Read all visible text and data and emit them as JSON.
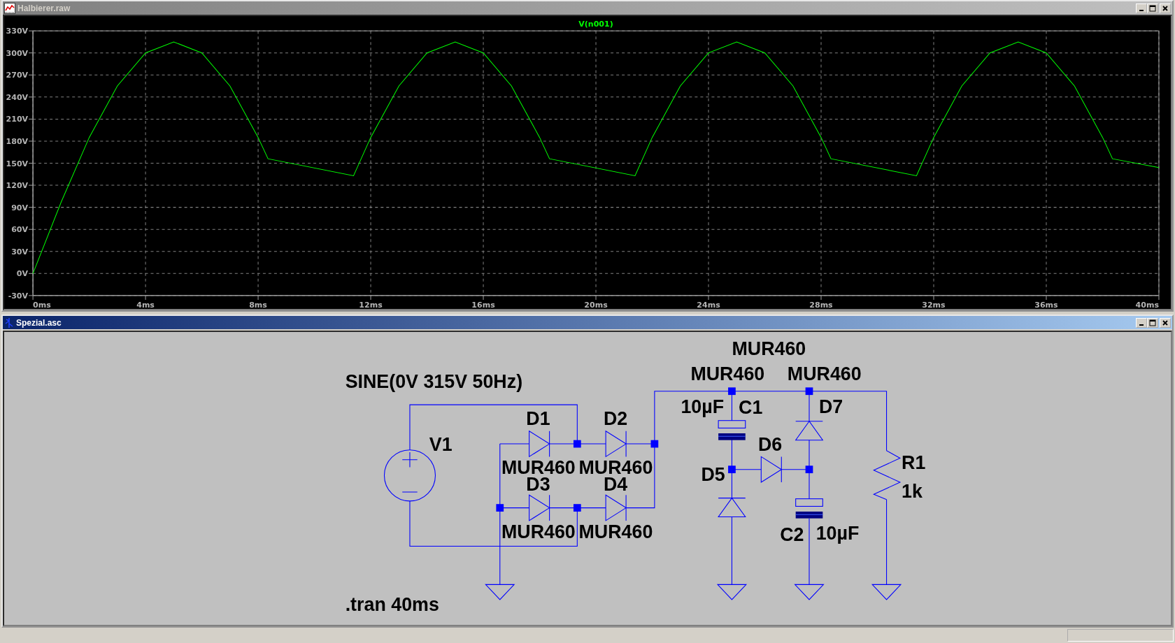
{
  "plot_window": {
    "title": "Halbierer.raw",
    "active": false,
    "chart_data": {
      "type": "line",
      "grid": true,
      "x": [
        0,
        1,
        2,
        3,
        4,
        5,
        6,
        7,
        8,
        8.35,
        11.39,
        12,
        13,
        14,
        15,
        16,
        17,
        18,
        18.35,
        21.39,
        22,
        23,
        24,
        25,
        26,
        27,
        28,
        28.35,
        31.39,
        32,
        33,
        34,
        35,
        36,
        37,
        38,
        38.35,
        40
      ],
      "series": [
        {
          "name": "V(n001)",
          "color": "#00ff00",
          "values": [
            0,
            97,
            185,
            255,
            300,
            315,
            300,
            255,
            185,
            156,
            133,
            185,
            255,
            300,
            315,
            300,
            255,
            185,
            156,
            133,
            185,
            255,
            300,
            315,
            300,
            255,
            185,
            156,
            133,
            185,
            255,
            300,
            315,
            300,
            255,
            185,
            156,
            144
          ]
        }
      ],
      "xlim": [
        0,
        40
      ],
      "ylim": [
        -30,
        330
      ],
      "xticks": [
        {
          "value": 0,
          "label": "0ms"
        },
        {
          "value": 4,
          "label": "4ms"
        },
        {
          "value": 8,
          "label": "8ms"
        },
        {
          "value": 12,
          "label": "12ms"
        },
        {
          "value": 16,
          "label": "16ms"
        },
        {
          "value": 20,
          "label": "20ms"
        },
        {
          "value": 24,
          "label": "24ms"
        },
        {
          "value": 28,
          "label": "28ms"
        },
        {
          "value": 32,
          "label": "32ms"
        },
        {
          "value": 36,
          "label": "36ms"
        },
        {
          "value": 40,
          "label": "40ms"
        }
      ],
      "yticks": [
        {
          "value": 330,
          "label": "330V"
        },
        {
          "value": 300,
          "label": "300V"
        },
        {
          "value": 270,
          "label": "270V"
        },
        {
          "value": 240,
          "label": "240V"
        },
        {
          "value": 210,
          "label": "210V"
        },
        {
          "value": 180,
          "label": "180V"
        },
        {
          "value": 150,
          "label": "150V"
        },
        {
          "value": 120,
          "label": "120V"
        },
        {
          "value": 90,
          "label": "90V"
        },
        {
          "value": 60,
          "label": "60V"
        },
        {
          "value": 30,
          "label": "30V"
        },
        {
          "value": 0,
          "label": "0V"
        },
        {
          "value": -30,
          "label": "-30V"
        }
      ]
    }
  },
  "schematic_window": {
    "title": "Spezial.asc",
    "active": true,
    "components": [
      {
        "kind": "voltage_source",
        "designator": "V1",
        "value": "SINE(0V 315V 50Hz)"
      },
      {
        "kind": "diode",
        "designator": "D1",
        "model": "MUR460"
      },
      {
        "kind": "diode",
        "designator": "D2",
        "model": "MUR460"
      },
      {
        "kind": "diode",
        "designator": "D3",
        "model": "MUR460"
      },
      {
        "kind": "diode",
        "designator": "D4",
        "model": "MUR460"
      },
      {
        "kind": "capacitor",
        "designator": "C1",
        "value": "10µF"
      },
      {
        "kind": "diode",
        "designator": "D5",
        "model": "MUR460"
      },
      {
        "kind": "diode",
        "designator": "D6",
        "model": "MUR460"
      },
      {
        "kind": "capacitor",
        "designator": "C2",
        "value": "10µF"
      },
      {
        "kind": "diode",
        "designator": "D7",
        "model": "MUR460"
      },
      {
        "kind": "resistor",
        "designator": "R1",
        "value": "1k"
      }
    ],
    "directive": ".tran 40ms"
  }
}
